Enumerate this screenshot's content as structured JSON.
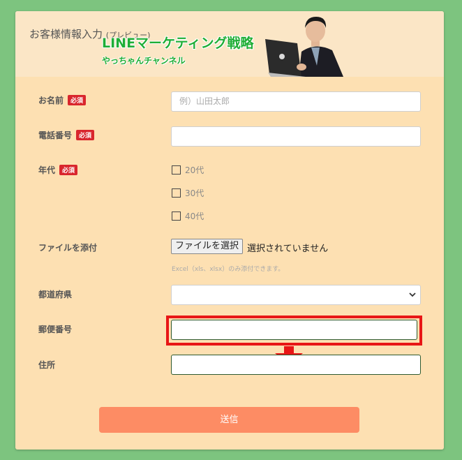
{
  "header": {
    "title": "お客様情報入力",
    "title_sub": "(プレビュー)",
    "banner_main": "LINEマーケティング戦略",
    "banner_sub": "やっちゃんチャンネル"
  },
  "form": {
    "required_badge": "必須",
    "name": {
      "label": "お名前",
      "placeholder": "例）山田太郎",
      "value": ""
    },
    "phone": {
      "label": "電話番号",
      "value": ""
    },
    "age": {
      "label": "年代",
      "options": [
        "20代",
        "30代",
        "40代"
      ]
    },
    "file": {
      "label": "ファイルを添付",
      "button": "ファイルを選択",
      "status": "選択されていません",
      "note": "Excel（xls、xlsx）のみ添付できます。"
    },
    "prefecture": {
      "label": "都道府県",
      "selected": ""
    },
    "postal": {
      "label": "郵便番号",
      "value": ""
    },
    "address": {
      "label": "住所",
      "value": ""
    },
    "submit": "送信"
  },
  "colors": {
    "background": "#7dc47f",
    "card": "#fde0b2",
    "required_badge": "#d9262d",
    "highlight": "#e81616",
    "submit": "#fd8c64",
    "banner_text": "#1fae36"
  }
}
